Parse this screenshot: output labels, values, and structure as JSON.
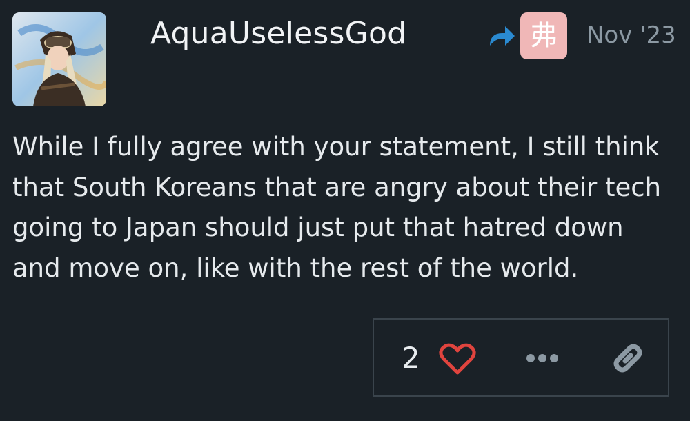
{
  "post": {
    "username": "AquaUselessGod",
    "reply_to_avatar_glyph": "弗",
    "date": "Nov '23",
    "body": "While I fully agree with your statement, I still think that South Koreans that are angry about their tech going to Japan should just put that hatred down and move on, like with the rest of the world."
  },
  "actions": {
    "like_count": "2"
  },
  "icons": {
    "reply": "reply-arrow-icon",
    "like": "heart-icon",
    "more": "ellipsis-icon",
    "link": "link-icon"
  },
  "colors": {
    "background": "#1a2127",
    "heart": "#e0443e",
    "reply_arrow": "#2a8ad1",
    "reply_avatar_bg": "#f0b7b7",
    "muted": "#8c99a3"
  }
}
